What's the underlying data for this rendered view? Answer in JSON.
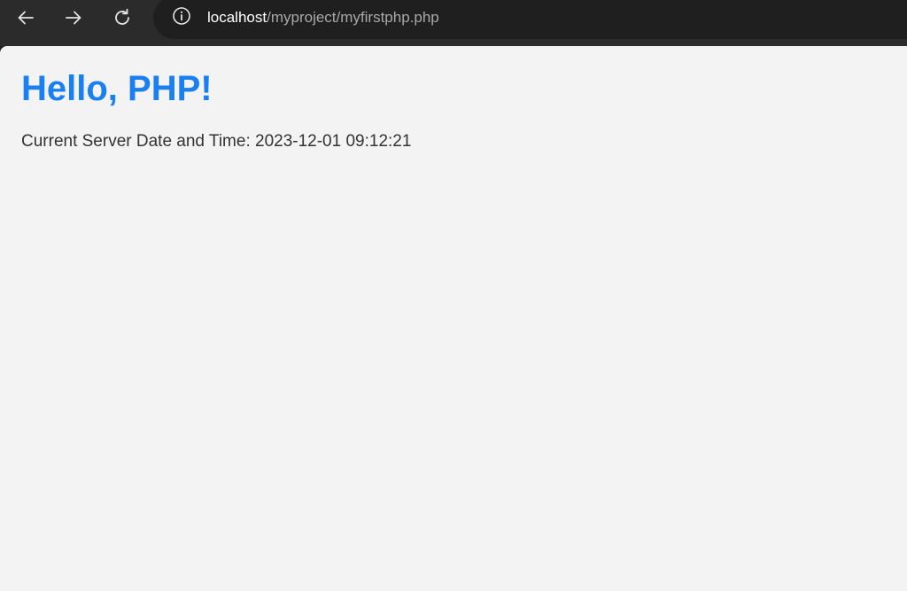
{
  "browser": {
    "nav": {
      "back_icon": "arrow-left-icon",
      "forward_icon": "arrow-right-icon",
      "reload_icon": "reload-icon"
    },
    "address_bar": {
      "info_icon": "info-circle-icon",
      "host": "localhost",
      "path": "/myproject/myfirstphp.php"
    }
  },
  "page": {
    "heading": "Hello, PHP!",
    "datetime_label": "Current Server Date and Time:",
    "datetime_value": "2023-12-01 09:12:21"
  },
  "colors": {
    "heading": "#1a7ff0",
    "page_background": "#f3f3f3",
    "toolbar_background": "#2b2b2b",
    "omnibox_background": "#1f1f1f",
    "body_text": "#333333"
  }
}
